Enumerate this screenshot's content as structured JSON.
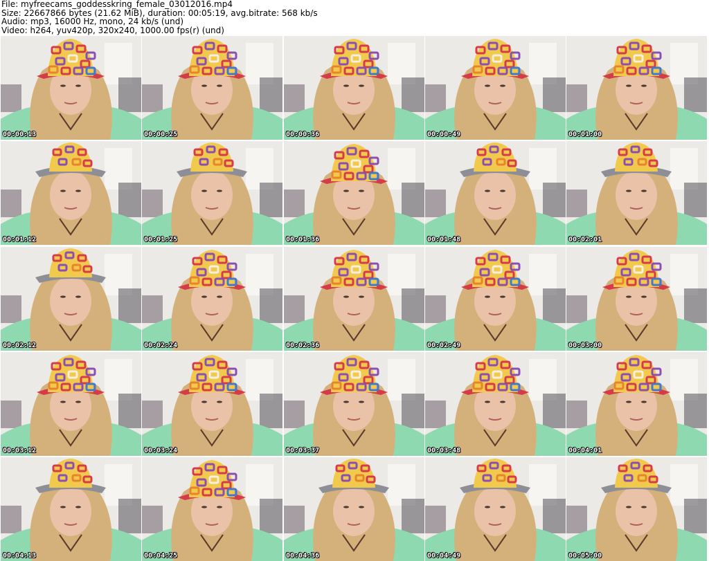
{
  "header": {
    "lines": [
      "File: myfreecams_goddesskring_female_03012016.mp4",
      "Size: 22667866 bytes (21.62 MiB), duration: 00:05:19, avg.bitrate: 568 kb/s",
      "Audio: mp3, 16000 Hz, mono, 24 kb/s (und)",
      "Video: h264, yuv420p, 320x240, 1000.00 fps(r) (und)"
    ]
  },
  "thumbnails": [
    {
      "timestamp": "00:00:13",
      "hat": "patterned"
    },
    {
      "timestamp": "00:00:25",
      "hat": "patterned"
    },
    {
      "timestamp": "00:00:36",
      "hat": "patterned"
    },
    {
      "timestamp": "00:00:49",
      "hat": "patterned"
    },
    {
      "timestamp": "00:01:00",
      "hat": "patterned"
    },
    {
      "timestamp": "00:01:12",
      "hat": "grey-brim"
    },
    {
      "timestamp": "00:01:25",
      "hat": "grey-brim"
    },
    {
      "timestamp": "00:01:36",
      "hat": "patterned"
    },
    {
      "timestamp": "00:01:48",
      "hat": "grey-brim"
    },
    {
      "timestamp": "00:02:01",
      "hat": "grey-brim"
    },
    {
      "timestamp": "00:02:12",
      "hat": "grey-brim"
    },
    {
      "timestamp": "00:02:24",
      "hat": "patterned"
    },
    {
      "timestamp": "00:02:36",
      "hat": "patterned"
    },
    {
      "timestamp": "00:02:49",
      "hat": "patterned"
    },
    {
      "timestamp": "00:03:00",
      "hat": "patterned"
    },
    {
      "timestamp": "00:03:12",
      "hat": "patterned"
    },
    {
      "timestamp": "00:03:24",
      "hat": "patterned"
    },
    {
      "timestamp": "00:03:37",
      "hat": "patterned"
    },
    {
      "timestamp": "00:03:48",
      "hat": "patterned"
    },
    {
      "timestamp": "00:04:01",
      "hat": "patterned"
    },
    {
      "timestamp": "00:04:13",
      "hat": "grey-brim"
    },
    {
      "timestamp": "00:04:25",
      "hat": "patterned"
    },
    {
      "timestamp": "00:04:36",
      "hat": "grey-brim"
    },
    {
      "timestamp": "00:04:49",
      "hat": "grey-brim"
    },
    {
      "timestamp": "00:05:00",
      "hat": "grey-brim"
    }
  ],
  "colors": {
    "wall": "#eceae6",
    "shirt": "#8fd9b0",
    "hair": "#d4b07a",
    "skin": "#e9c2a8",
    "hat_red": "#d63b4a",
    "hat_yellow": "#f1c94d",
    "hat_purple": "#8a4fb0",
    "hat_grey": "#8e8e96"
  }
}
